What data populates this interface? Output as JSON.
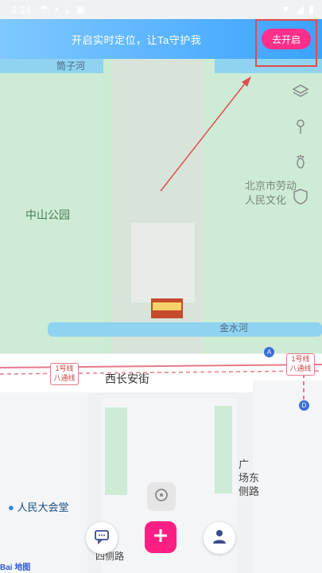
{
  "status_bar": {
    "time": "4:14"
  },
  "banner": {
    "text": "开启实时定位，让Ta守护我",
    "button_label": "去开启"
  },
  "map_labels": {
    "tongzi_river": "筒子河",
    "zhongshan_park": "中山公园",
    "labor_palace_line1": "北京市劳动",
    "labor_palace_line2": "人民文化",
    "jinshui_river": "金水河",
    "xichang_an_street": "西长安街",
    "line1_badge_left_a": "1号线",
    "line1_badge_left_b": "八通线",
    "line1_badge_right_a": "1号线",
    "line1_badge_right_b": "八通线",
    "guangchang_line1": "广",
    "guangchang_line2": "场东",
    "guangchang_line3": "侧路",
    "west_side_road": "四侧路",
    "great_hall": "人民大会堂",
    "metro_a": "A",
    "metro_d": "D"
  },
  "baidu_logo": {
    "text": "Bai 地图"
  },
  "colors": {
    "banner_start": "#7fc8ff",
    "banner_end": "#3aa2ff",
    "cta": "#ff2f8a",
    "plus_button": "#ff1f84",
    "annotation_red": "#e24c4c"
  }
}
